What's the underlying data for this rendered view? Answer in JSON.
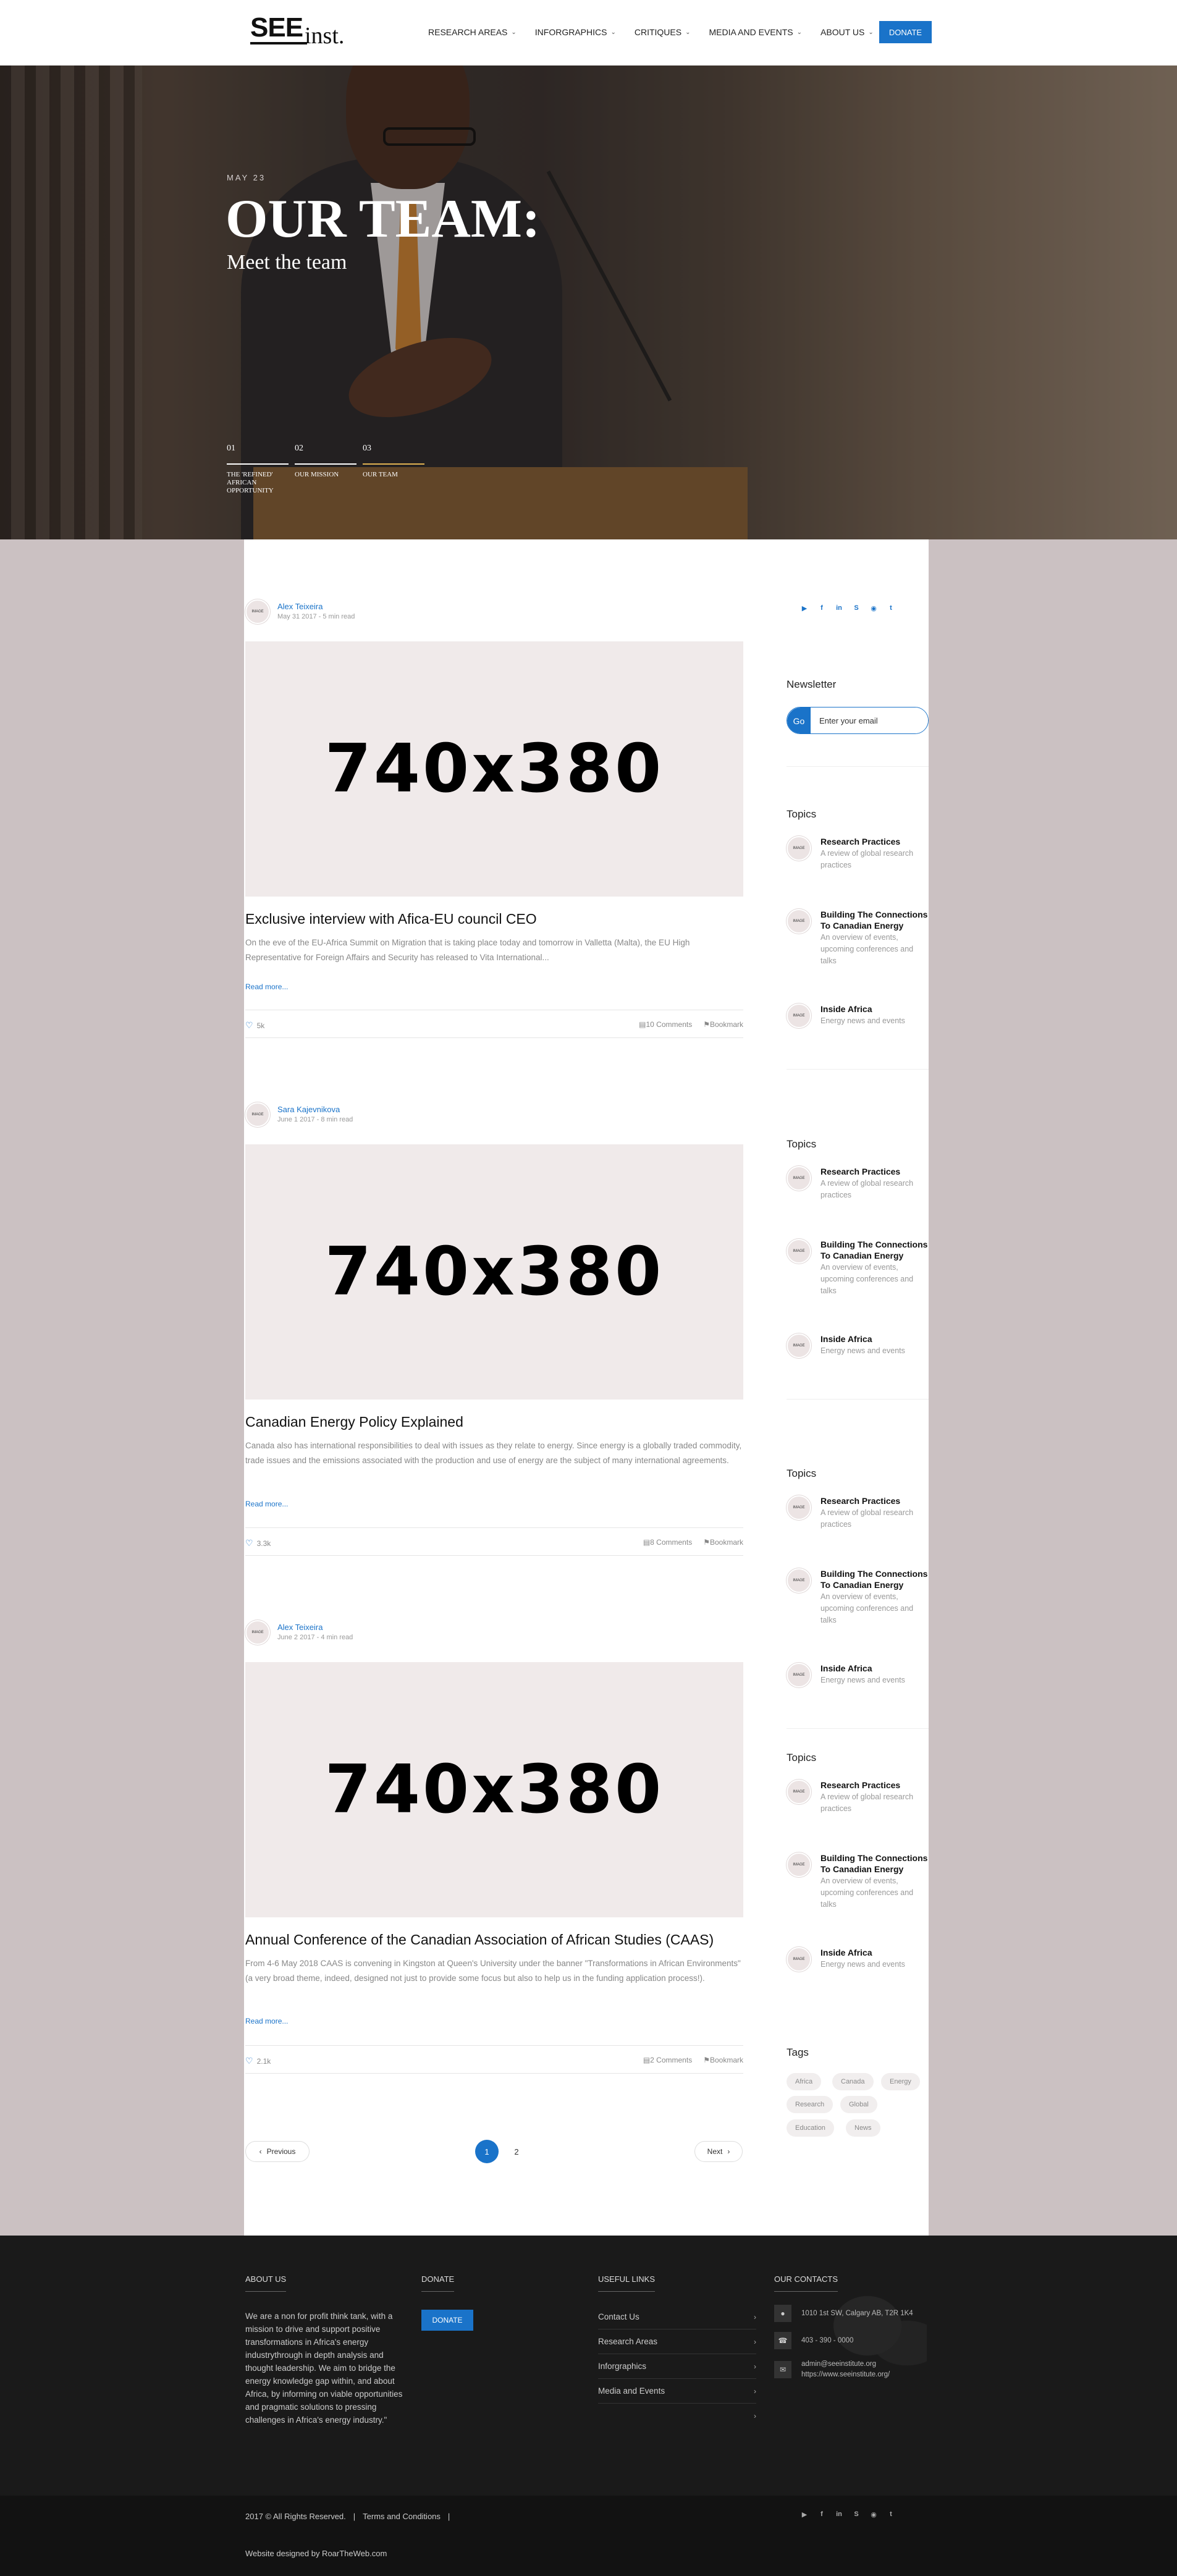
{
  "nav": {
    "logo_see": "SEE",
    "logo_inst": "inst.",
    "items": [
      {
        "label": "RESEARCH AREAS"
      },
      {
        "label": "INFORGRAPHICS"
      },
      {
        "label": "CRITIQUES"
      },
      {
        "label": "MEDIA AND EVENTS"
      },
      {
        "label": "ABOUT US"
      }
    ],
    "donate": "DONATE"
  },
  "hero": {
    "date": "MAY 23",
    "title": "OUR TEAM:",
    "subtitle": "Meet the team",
    "steps": [
      {
        "num": "01",
        "label": "THE 'REFINED' AFRICAN OPPORTUNITY"
      },
      {
        "num": "02",
        "label": "OUR MISSION"
      },
      {
        "num": "03",
        "label": "OUR TEAM"
      }
    ]
  },
  "placeholder_text": "740x380",
  "avatar_text": "IMAGE",
  "articles": [
    {
      "author": "Alex Teixeira",
      "date": "May 31 2017 - 5 min read",
      "title": "Exclusive interview with Afica-EU council CEO",
      "excerpt": "On the eve of the EU-Africa Summit on Migration that is taking place today and tomorrow in Valletta (Malta), the EU High Representative for Foreign Affairs and Security has released to Vita International...",
      "more": "Read more...",
      "likes": "5k",
      "comments": "10 Comments",
      "bookmark": "Bookmark"
    },
    {
      "author": "Sara Kajevnikova",
      "date": "June 1 2017 - 8 min read",
      "title": "Canadian Energy Policy Explained",
      "excerpt": "Canada also has international responsibilities to deal with issues as they relate to energy. Since energy is a globally traded commodity, trade issues and the emissions associated with the production and use of energy are the subject of many international agreements.",
      "more": "Read more...",
      "likes": "3.3k",
      "comments": "8 Comments",
      "bookmark": "Bookmark"
    },
    {
      "author": "Alex Teixeira",
      "date": "June 2 2017 - 4 min read",
      "title": "Annual Conference of the Canadian Association of African Studies (CAAS)",
      "excerpt": "From 4-6 May 2018 CAAS is convening in Kingston at Queen's University under the banner \"Transformations in African Environments\" (a very broad theme, indeed, designed not just to provide some focus but also to help us in the funding application process!).",
      "more": "Read more...",
      "likes": "2.1k",
      "comments": "2 Comments",
      "bookmark": "Bookmark"
    }
  ],
  "pagination": {
    "prev": "Previous",
    "next": "Next",
    "pages": [
      "1",
      "2"
    ],
    "current": "1"
  },
  "sidebar": {
    "social": [
      "youtube-icon",
      "facebook-icon",
      "linkedin-icon",
      "skype-icon",
      "instagram-icon",
      "twitter-icon"
    ],
    "newsletter_heading": "Newsletter",
    "newsletter_go": "Go",
    "newsletter_placeholder": "Enter your email",
    "topics_heading": "Topics",
    "topics": [
      {
        "title": "Research Practices",
        "desc": "A review of global research practices"
      },
      {
        "title": "Building The Connections To Canadian Energy",
        "desc": "An overview of events, upcoming conferences and talks"
      },
      {
        "title": "Inside Africa",
        "desc": "Energy news and events"
      }
    ],
    "tags_heading": "Tags",
    "tags": [
      "Africa",
      "Canada",
      "Energy",
      "Research",
      "Global",
      "Education",
      "News"
    ]
  },
  "footer": {
    "about_heading": "ABOUT US",
    "about_text": "We are a non for profit think tank, with a mission to drive and support positive transformations in Africa's energy industrythrough in depth analysis and thought leadership. We aim to bridge the energy knowledge gap within, and about Africa, by informing on viable opportunities and pragmatic solutions to pressing challenges in Africa's energy industry.\"",
    "donate_heading": "DONATE",
    "donate_button": "DONATE",
    "links_heading": "USEFUL LINKS",
    "links": [
      "Contact Us",
      "Research Areas",
      "Inforgraphics",
      "Media and Events",
      ""
    ],
    "contacts_heading": "OUR CONTACTS",
    "address": "1010 1st SW, Calgary AB, T2R 1K4",
    "phone": "403 - 390 - 0000",
    "email": "admin@seeinstitute.org",
    "website": "https://www.seeinstitute.org/",
    "copyright": "2017 © All Rights Reserved.",
    "sep": "|",
    "terms": "Terms and Conditions",
    "designed": "Website designed by RoarTheWeb.com"
  },
  "colors": {
    "accent": "#1a73c9",
    "footer_bg": "#1a1a1a",
    "page_bg": "#cbc1c2"
  }
}
